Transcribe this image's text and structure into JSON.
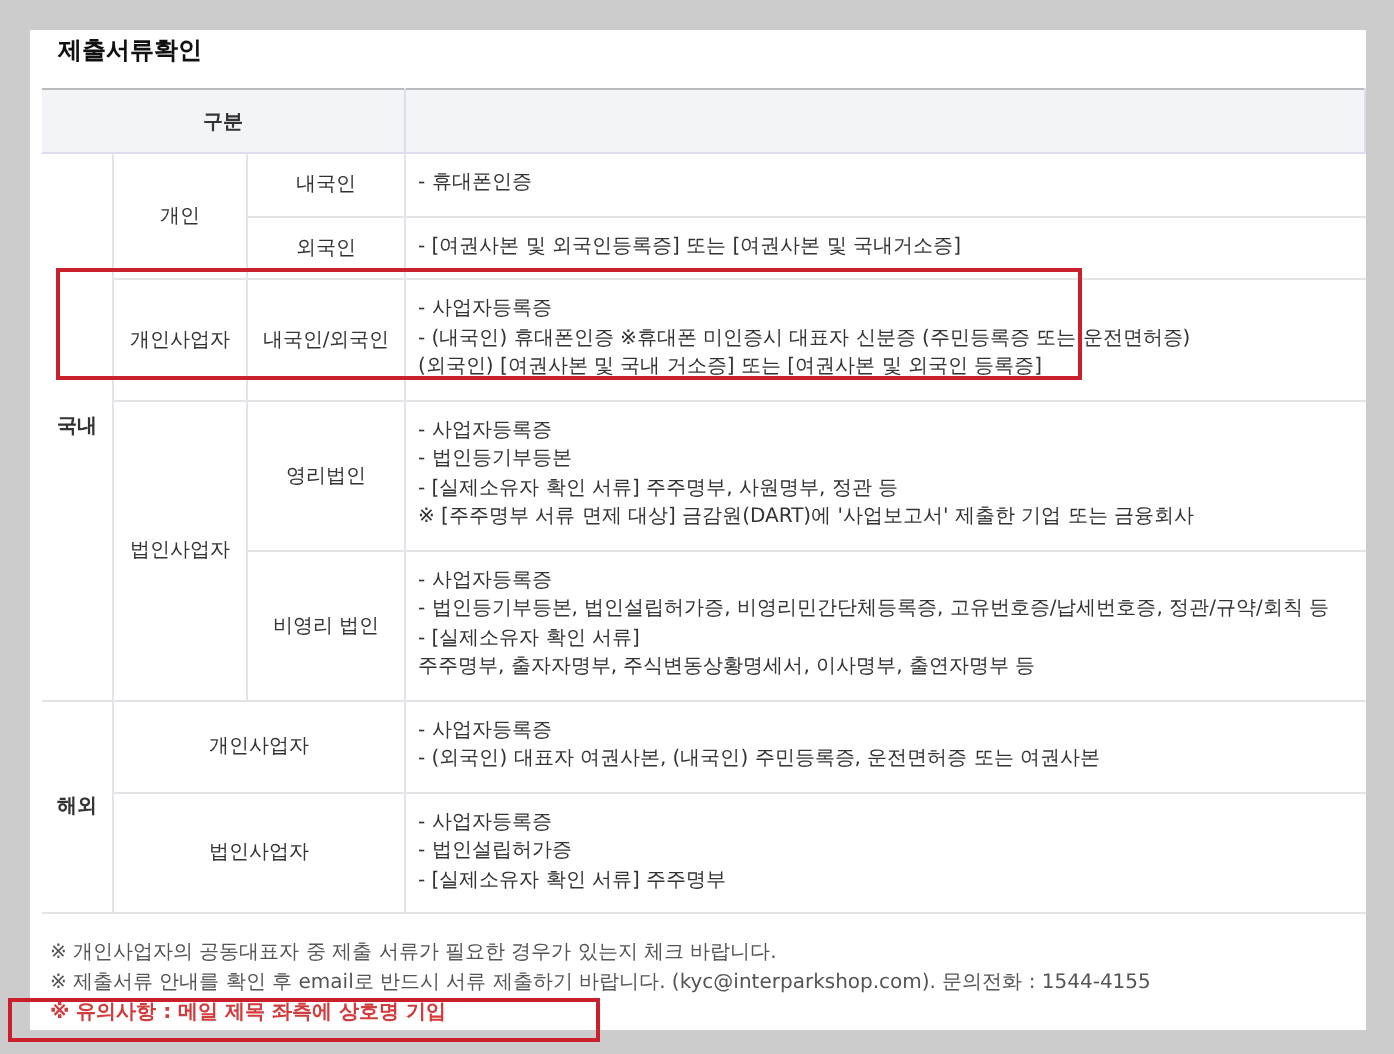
{
  "title": "제출서류확인",
  "table": {
    "header": "구분",
    "groups": [
      {
        "region": "국내",
        "categories": [
          {
            "name": "개인",
            "types": [
              {
                "name": "내국인",
                "documents": [
                  "- 휴대폰인증"
                ]
              },
              {
                "name": "외국인",
                "documents": [
                  "- [여권사본 및 외국인등록증] 또는 [여권사본 및 국내거소증]"
                ]
              }
            ]
          },
          {
            "name": "개인사업자",
            "types": [
              {
                "name": "내국인/외국인",
                "documents": [
                  "- 사업자등록증",
                  "- (내국인) 휴대폰인증 ※휴대폰 미인증시 대표자 신분증 (주민등록증 또는 운전면허증)",
                  "(외국인) [여권사본 및 국내 거소증] 또는 [여권사본 및 외국인 등록증]"
                ]
              }
            ]
          },
          {
            "name": "법인사업자",
            "types": [
              {
                "name": "영리법인",
                "documents": [
                  "- 사업자등록증",
                  "- 법인등기부등본",
                  "- [실제소유자 확인 서류] 주주명부, 사원명부, 정관 등",
                  "※ [주주명부 서류 면제 대상] 금감원(DART)에 '사업보고서' 제출한 기업 또는 금융회사"
                ]
              },
              {
                "name": "비영리 법인",
                "documents": [
                  "- 사업자등록증",
                  "- 법인등기부등본, 법인설립허가증, 비영리민간단체등록증, 고유번호증/납세번호증, 정관/규약/회칙 등",
                  "- [실제소유자 확인 서류]",
                  "주주명부, 출자자명부, 주식변동상황명세서, 이사명부, 출연자명부 등"
                ]
              }
            ]
          }
        ]
      },
      {
        "region": "해외",
        "categories": [
          {
            "name": "개인사업자",
            "documents": [
              "- 사업자등록증",
              "- (외국인) 대표자 여권사본, (내국인) 주민등록증, 운전면허증 또는 여권사본"
            ]
          },
          {
            "name": "법인사업자",
            "documents": [
              "- 사업자등록증",
              "- 법인설립허가증",
              "- [실제소유자 확인 서류] 주주명부"
            ]
          }
        ]
      }
    ]
  },
  "notes": [
    "※ 개인사업자의 공동대표자 중 제출 서류가 필요한 경우가 있는지 체크 바랍니다.",
    "※ 제출서류 안내를 확인 후 email로 반드시 서류 제출하기 바랍니다. (kyc@interparkshop.com). 문의전화 : 1544-4155"
  ],
  "warning": "※ 유의사항 : 메일 제목 좌측에 상호명 기입"
}
